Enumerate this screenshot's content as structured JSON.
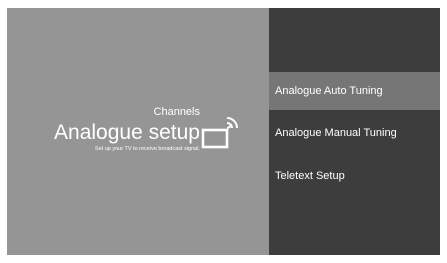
{
  "left_panel": {
    "category": "Channels",
    "title": "Analogue setup",
    "description": "Set up your TV to receive broadcast signal.",
    "icon": "tv-signal-icon"
  },
  "menu": {
    "items": [
      {
        "label": "Analogue Auto Tuning",
        "selected": true
      },
      {
        "label": "Analogue Manual Tuning",
        "selected": false
      },
      {
        "label": "Teletext Setup",
        "selected": false
      }
    ]
  },
  "colors": {
    "left_bg": "#959595",
    "right_bg": "#3d3d3d",
    "selected_bg": "#767676",
    "text": "#ffffff"
  }
}
